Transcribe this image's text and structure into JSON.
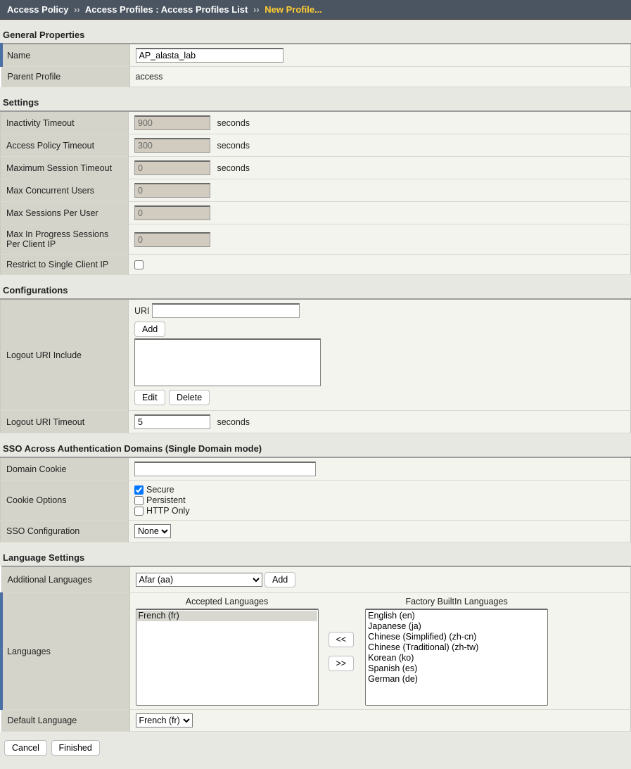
{
  "breadcrumb": {
    "root": "Access Policy",
    "mid": "Access Profiles : Access Profiles List",
    "current": "New Profile...",
    "sep": "››"
  },
  "sections": {
    "general": "General Properties",
    "settings": "Settings",
    "config": "Configurations",
    "sso": "SSO Across Authentication Domains (Single Domain mode)",
    "lang": "Language Settings"
  },
  "general": {
    "name_label": "Name",
    "name_value": "AP_alasta_lab",
    "parent_label": "Parent Profile",
    "parent_value": "access"
  },
  "settings": {
    "inactivity_label": "Inactivity Timeout",
    "inactivity_value": "900",
    "policy_timeout_label": "Access Policy Timeout",
    "policy_timeout_value": "300",
    "max_session_label": "Maximum Session Timeout",
    "max_session_value": "0",
    "max_users_label": "Max Concurrent Users",
    "max_users_value": "0",
    "max_per_user_label": "Max Sessions Per User",
    "max_per_user_value": "0",
    "max_inprog_label": "Max In Progress Sessions Per Client IP",
    "max_inprog_value": "0",
    "restrict_label": "Restrict to Single Client IP",
    "seconds": "seconds"
  },
  "config": {
    "logout_inc_label": "Logout URI Include",
    "uri_label": "URI",
    "add": "Add",
    "edit": "Edit",
    "delete": "Delete",
    "logout_timeout_label": "Logout URI Timeout",
    "logout_timeout_value": "5"
  },
  "sso": {
    "domain_cookie_label": "Domain Cookie",
    "domain_cookie_value": "",
    "cookie_opts_label": "Cookie Options",
    "secure": "Secure",
    "persistent": "Persistent",
    "httponly": "HTTP Only",
    "sso_config_label": "SSO Configuration",
    "sso_config_value": "None"
  },
  "lang": {
    "add_lang_label": "Additional Languages",
    "add_lang_value": "Afar (aa)",
    "add": "Add",
    "languages_label": "Languages",
    "accepted_title": "Accepted Languages",
    "builtin_title": "Factory BuiltIn Languages",
    "accepted": [
      "French (fr)"
    ],
    "builtin": [
      "English (en)",
      "Japanese (ja)",
      "Chinese (Simplified) (zh-cn)",
      "Chinese (Traditional) (zh-tw)",
      "Korean (ko)",
      "Spanish (es)",
      "German (de)"
    ],
    "move_left": "<<",
    "move_right": ">>",
    "default_label": "Default Language",
    "default_value": "French (fr)"
  },
  "footer": {
    "cancel": "Cancel",
    "finished": "Finished"
  }
}
